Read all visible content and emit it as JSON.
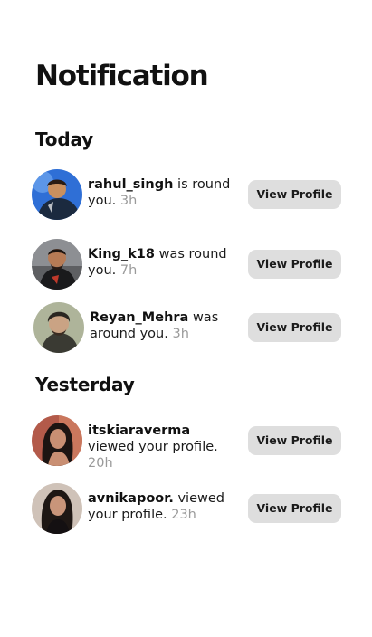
{
  "header": {
    "title": "Notification"
  },
  "sections": [
    {
      "label": "Today",
      "items": [
        {
          "username": "rahul_singh",
          "message": " is round you.",
          "time": "3h",
          "button": "View Profile",
          "avatar_icon": "avatar-rahul-photo",
          "avatar_colors": [
            "#2f6fd6",
            "#1b2a3f",
            "#c9905f"
          ]
        },
        {
          "username": "King_k18",
          "message": " was round you.",
          "time": "7h",
          "button": "View Profile",
          "avatar_icon": "avatar-king-photo",
          "avatar_colors": [
            "#8d8f93",
            "#1a1a1c",
            "#b77b55"
          ]
        },
        {
          "username": "Reyan_Mehra",
          "message": " was around you.",
          "time": "3h",
          "button": "View Profile",
          "avatar_icon": "avatar-reyan-photo",
          "avatar_colors": [
            "#aeb49a",
            "#2a2621",
            "#caa384"
          ]
        }
      ]
    },
    {
      "label": "Yesterday",
      "items": [
        {
          "username": "itskiaraverma",
          "message": " viewed your profile.",
          "time": "20h",
          "button": "View Profile",
          "avatar_icon": "avatar-kiara-photo",
          "avatar_colors": [
            "#b35a4a",
            "#1c1412",
            "#c98f73"
          ]
        },
        {
          "username": "avnikapoor.",
          "message": " viewed your profile.",
          "time": "23h",
          "button": "View Profile",
          "avatar_icon": "avatar-avni-photo",
          "avatar_colors": [
            "#cfc2b8",
            "#1e1714",
            "#c9957a"
          ]
        }
      ]
    }
  ]
}
